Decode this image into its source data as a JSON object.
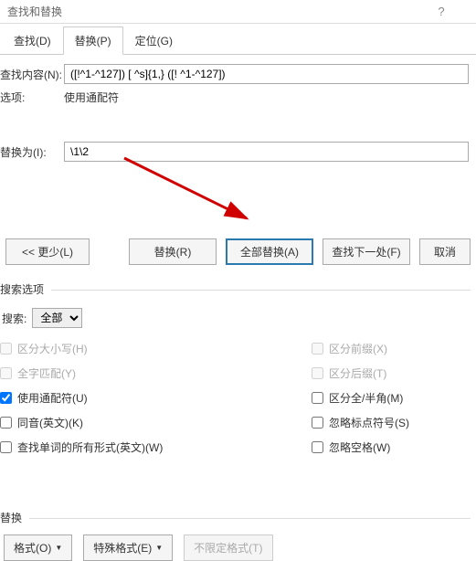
{
  "titlebar": {
    "title": "查找和替换"
  },
  "tabs": {
    "find": "查找(D)",
    "replace": "替换(P)",
    "goto": "定位(G)"
  },
  "find": {
    "label": "查找内容(N):",
    "value": "([!^1-^127]) [ ^s]{1,} ([! ^1-^127])",
    "options_label": "选项:",
    "options_value": "使用通配符"
  },
  "replace": {
    "label": "替换为(I):",
    "value": "\\1\\2"
  },
  "buttons": {
    "less": "<< 更少(L)",
    "replace": "替换(R)",
    "replace_all": "全部替换(A)",
    "find_next": "查找下一处(F)",
    "cancel": "取消"
  },
  "search_options": {
    "legend": "搜索选项",
    "search_label": "搜索:",
    "search_value": "全部",
    "left": {
      "match_case": "区分大小写(H)",
      "whole_word": "全字匹配(Y)",
      "use_wildcards": "使用通配符(U)",
      "sounds_like": "同音(英文)(K)",
      "all_word_forms": "查找单词的所有形式(英文)(W)"
    },
    "right": {
      "prefix": "区分前缀(X)",
      "suffix": "区分后缀(T)",
      "full_half": "区分全/半角(M)",
      "ignore_punct": "忽略标点符号(S)",
      "ignore_space": "忽略空格(W)"
    }
  },
  "bottom": {
    "legend": "替换",
    "format": "格式(O)",
    "special": "特殊格式(E)",
    "no_format": "不限定格式(T)"
  }
}
